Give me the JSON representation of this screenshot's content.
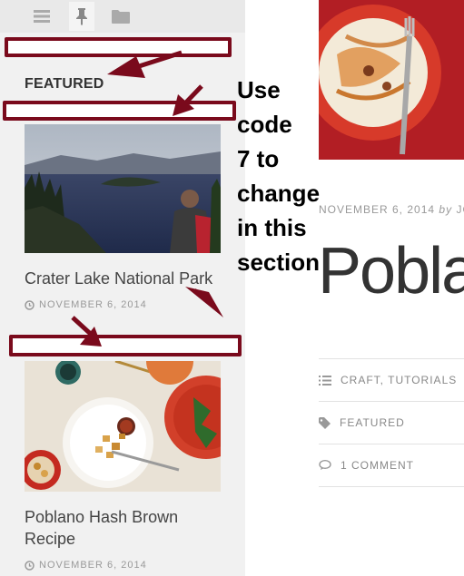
{
  "sidebar": {
    "tabs": [
      {
        "name": "menu",
        "icon": "menu-icon"
      },
      {
        "name": "featured",
        "icon": "pin-icon"
      },
      {
        "name": "folder",
        "icon": "folder-icon"
      }
    ],
    "heading": "FEATURED",
    "posts": [
      {
        "title": "Crater Lake National Park",
        "date": "NOVEMBER 6, 2014"
      },
      {
        "title": "Poblano Hash Brown Recipe",
        "date": "NOVEMBER 6, 2014"
      }
    ]
  },
  "main": {
    "meta_date": "NOVEMBER 6, 2014",
    "meta_by": "by",
    "meta_author": "JO",
    "title": "Pobla",
    "categories": "CRAFT, TUTORIALS",
    "tags": "FEATURED",
    "comments": "1 COMMENT"
  },
  "annotation": {
    "lines": [
      "Use",
      "code",
      "7 to",
      "change",
      "in this",
      "section"
    ],
    "color": "#7a0a1c"
  }
}
